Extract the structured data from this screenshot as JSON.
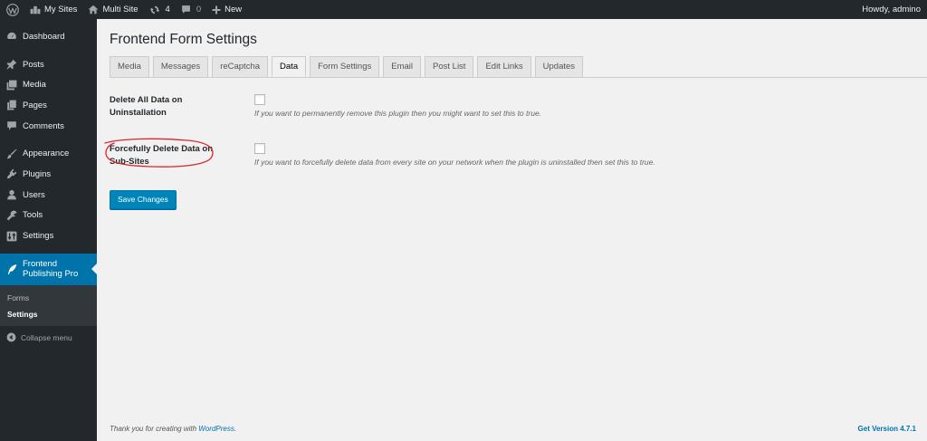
{
  "admin_bar": {
    "my_sites": "My Sites",
    "site_name": "Multi Site",
    "updates_count": "4",
    "comments_count": "0",
    "new_label": "New",
    "greeting": "Howdy, admino"
  },
  "sidebar": {
    "items": [
      {
        "label": "Dashboard",
        "icon": "dashboard-icon"
      },
      {
        "label": "Posts",
        "icon": "pushpin-icon"
      },
      {
        "label": "Media",
        "icon": "media-icon"
      },
      {
        "label": "Pages",
        "icon": "pages-icon"
      },
      {
        "label": "Comments",
        "icon": "comment-icon"
      },
      {
        "label": "Appearance",
        "icon": "paintbrush-icon"
      },
      {
        "label": "Plugins",
        "icon": "plugin-icon"
      },
      {
        "label": "Users",
        "icon": "user-icon"
      },
      {
        "label": "Tools",
        "icon": "wrench-icon"
      },
      {
        "label": "Settings",
        "icon": "settings-icon"
      }
    ],
    "current": {
      "label_line1": "Frontend",
      "label_line2": "Publishing Pro",
      "icon": "quill-icon"
    },
    "submenu": [
      {
        "label": "Forms"
      },
      {
        "label": "Settings"
      }
    ],
    "collapse_label": "Collapse menu"
  },
  "main": {
    "title": "Frontend Form Settings",
    "tabs": [
      {
        "label": "Media"
      },
      {
        "label": "Messages"
      },
      {
        "label": "reCaptcha"
      },
      {
        "label": "Data"
      },
      {
        "label": "Form Settings"
      },
      {
        "label": "Email"
      },
      {
        "label": "Post List"
      },
      {
        "label": "Edit Links"
      },
      {
        "label": "Updates"
      }
    ],
    "active_tab": "Data",
    "settings": [
      {
        "label_line1": "Delete All Data on",
        "label_line2": "Uninstallation",
        "checked": false,
        "description": "If you want to permanently remove this plugin then you might want to set this to true."
      },
      {
        "label_line1": "Forcefully Delete Data on",
        "label_line2": "Sub-Sites",
        "checked": false,
        "description": "If you want to forcefully delete data from every site on your network when the plugin is uninstalled then set this to true."
      }
    ],
    "save_label": "Save Changes"
  },
  "footer": {
    "thanks_prefix": "Thank you for creating with ",
    "thanks_link": "WordPress",
    "thanks_suffix": ".",
    "version": "Get Version 4.7.1"
  },
  "colors": {
    "admin_bar_bg": "#23282d",
    "accent": "#0073aa",
    "button": "#0085ba",
    "content_bg": "#f1f1f1",
    "annotation": "#d9262d"
  }
}
